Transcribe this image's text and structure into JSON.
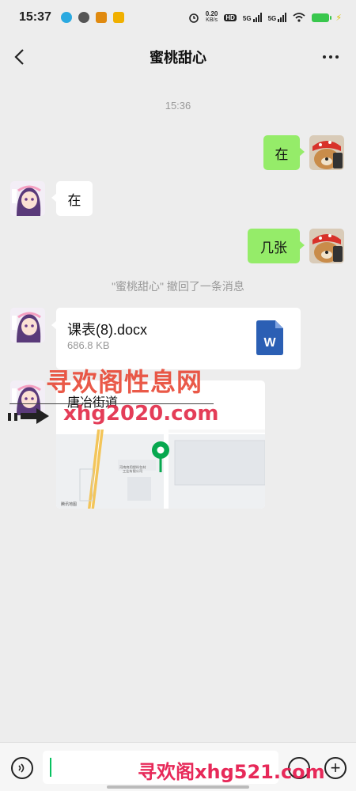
{
  "status_bar": {
    "time": "15:37",
    "net_speed_value": "0.20",
    "net_speed_unit": "KB/s",
    "hd_label": "HD",
    "signal1_label": "5G",
    "signal2_label": "5G",
    "icons": [
      "qq-icon",
      "wechat-icon",
      "app-icon",
      "app2-icon",
      "alarm-icon",
      "wifi-icon",
      "battery-icon"
    ]
  },
  "header": {
    "title": "蜜桃甜心"
  },
  "chat": {
    "timestamp": "15:36",
    "messages": [
      {
        "sender": "me",
        "text": "在"
      },
      {
        "sender": "other",
        "text": "在"
      },
      {
        "sender": "me",
        "text": "几张"
      }
    ],
    "recall_notice": "\"蜜桃甜心\" 撤回了一条消息",
    "file": {
      "name": "课表(8).docx",
      "size": "686.8 KB",
      "icon_letter": "W"
    },
    "location": {
      "title": "唐冶街道",
      "map_label_1": "河南商用塑料包材",
      "map_label_2": "工业有限公司",
      "map_source": "腾讯地图"
    }
  },
  "watermarks": {
    "line1": "寻欢阁性息网",
    "line2": "xhg2020.com",
    "line3": "寻欢阁xhg521.com"
  },
  "input_bar": {
    "placeholder": ""
  },
  "colors": {
    "my_bubble": "#95ec69",
    "other_bubble": "#ffffff",
    "background": "#ededed",
    "accent": "#07c160"
  }
}
